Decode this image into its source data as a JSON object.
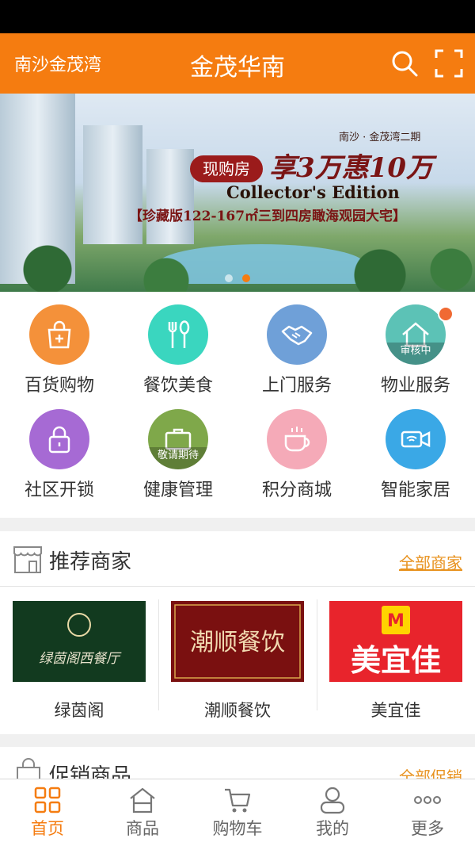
{
  "header": {
    "location": "南沙金茂湾",
    "title": "金茂华南"
  },
  "banner": {
    "subtitle": "南沙 · 金茂湾二期",
    "badge": "现购房",
    "headline": "享3万惠10万",
    "edition": "Collector's Edition",
    "tagline": "【珍藏版122-167㎡三到四房瞰海观园大宅】",
    "active_slide": 2,
    "slide_count": 2
  },
  "services": [
    {
      "label": "百货购物",
      "icon": "shopping-bag-icon",
      "color": "#f4913a"
    },
    {
      "label": "餐饮美食",
      "icon": "fork-spoon-icon",
      "color": "#3ad6bf"
    },
    {
      "label": "上门服务",
      "icon": "handshake-icon",
      "color": "#6fa0d8"
    },
    {
      "label": "物业服务",
      "icon": "house-icon",
      "color": "#5cc2b6",
      "badge": "审核中"
    },
    {
      "label": "社区开锁",
      "icon": "lock-icon",
      "color": "#a66ad4"
    },
    {
      "label": "健康管理",
      "icon": "briefcase-icon",
      "color": "#7fa84a",
      "badge": "敬请期待"
    },
    {
      "label": "积分商城",
      "icon": "cup-icon",
      "color": "#f5aab8"
    },
    {
      "label": "智能家居",
      "icon": "camera-wifi-icon",
      "color": "#3aa8e6"
    }
  ],
  "recommended": {
    "title": "推荐商家",
    "more": "全部商家",
    "merchants": [
      {
        "name": "绿茵阁",
        "logo_text": "绿茵阁西餐厅",
        "logo_bg": "#123a1f"
      },
      {
        "name": "潮顺餐饮",
        "logo_text": "潮顺餐饮",
        "logo_bg": "#7a1010"
      },
      {
        "name": "美宜佳",
        "logo_text": "美宜佳",
        "logo_bg": "#e8242c"
      }
    ]
  },
  "promotion": {
    "title": "促销商品",
    "more": "全部促销"
  },
  "tabbar": [
    {
      "label": "首页",
      "icon": "home-grid-icon",
      "active": true
    },
    {
      "label": "商品",
      "icon": "house-outline-icon",
      "active": false
    },
    {
      "label": "购物车",
      "icon": "cart-icon",
      "active": false
    },
    {
      "label": "我的",
      "icon": "user-icon",
      "active": false
    },
    {
      "label": "更多",
      "icon": "more-dots-icon",
      "active": false
    }
  ],
  "colors": {
    "accent": "#f57c10",
    "link": "#e8921e"
  }
}
